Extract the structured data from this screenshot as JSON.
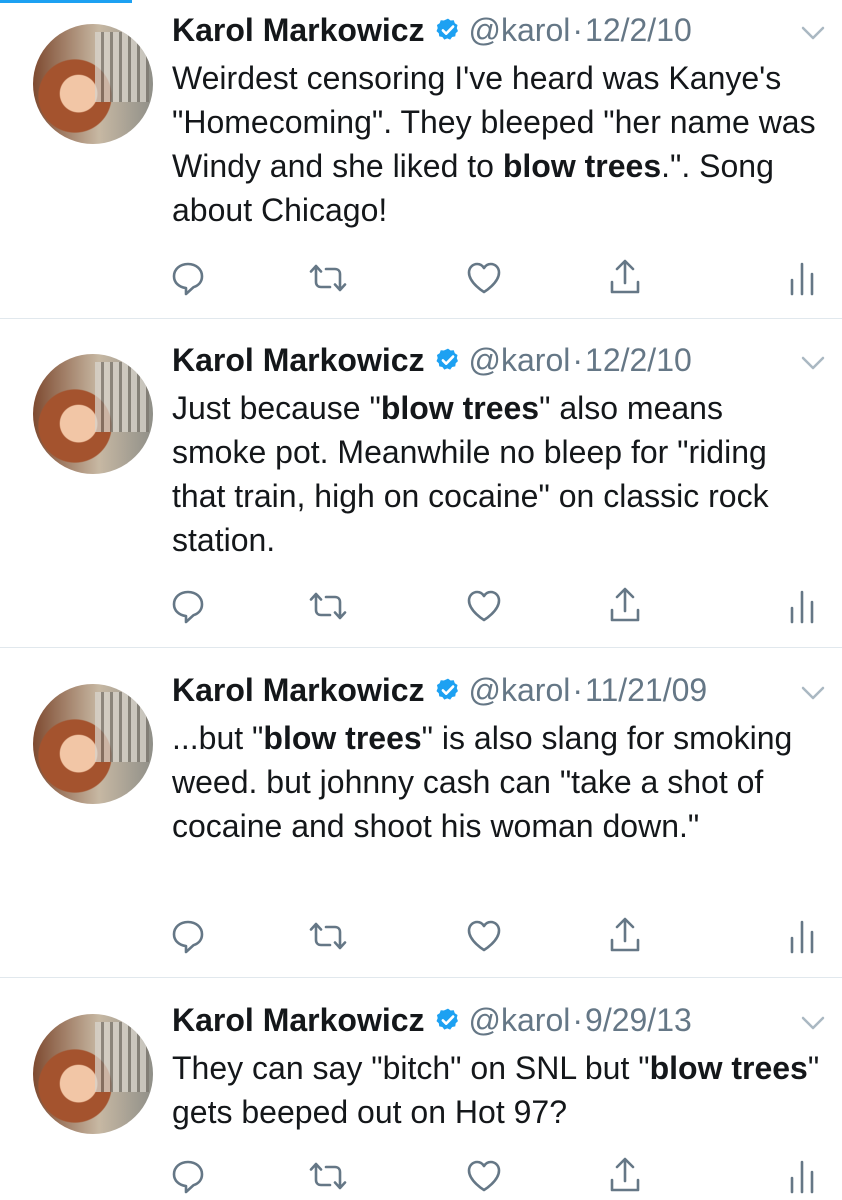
{
  "author": {
    "name": "Karol Markowicz",
    "handle": "@karol",
    "separator": "·"
  },
  "colors": {
    "text": "#14171a",
    "secondary": "#657786",
    "verified": "#1da1f2",
    "divider": "#e1e8ed"
  },
  "icons": [
    "verified-badge-icon",
    "chevron-down-icon",
    "reply-icon",
    "retweet-icon",
    "like-icon",
    "share-icon",
    "analytics-icon"
  ],
  "tweets": [
    {
      "date": "12/2/10",
      "text_parts": [
        {
          "text": "Weirdest censoring I've heard was Kanye's \"Homecoming\".  They bleeped \"her name was Windy and she liked to ",
          "bold": false
        },
        {
          "text": "blow trees",
          "bold": true
        },
        {
          "text": ".\". Song about Chicago!",
          "bold": false
        }
      ]
    },
    {
      "date": "12/2/10",
      "text_parts": [
        {
          "text": "Just because \"",
          "bold": false
        },
        {
          "text": "blow trees",
          "bold": true
        },
        {
          "text": "\" also means smoke pot.  Meanwhile no bleep for \"riding that train, high on cocaine\" on classic rock station.",
          "bold": false
        }
      ]
    },
    {
      "date": "11/21/09",
      "text_parts": [
        {
          "text": "...but \"",
          "bold": false
        },
        {
          "text": "blow trees",
          "bold": true
        },
        {
          "text": "\" is also slang for smoking weed.  but johnny cash can \"take a shot of cocaine and shoot his woman down.\"",
          "bold": false
        }
      ]
    },
    {
      "date": "9/29/13",
      "text_parts": [
        {
          "text": "They can say \"bitch\" on SNL but \"",
          "bold": false
        },
        {
          "text": "blow trees",
          "bold": true
        },
        {
          "text": "\" gets beeped out on Hot 97?",
          "bold": false
        }
      ]
    }
  ]
}
